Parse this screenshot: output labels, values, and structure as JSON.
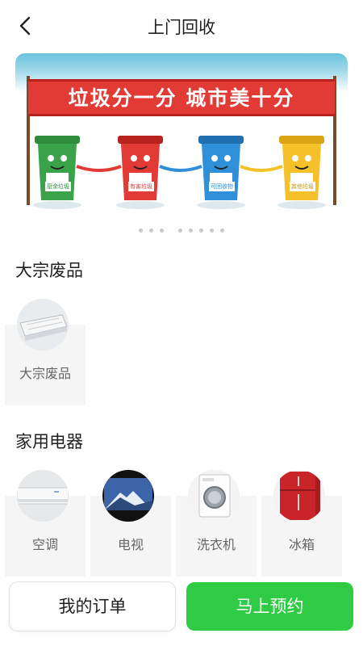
{
  "header": {
    "title": "上门回收",
    "back_icon": "chevron-left-icon"
  },
  "banner": {
    "slogan": "垃圾分一分  城市美十分",
    "bins": [
      {
        "label": "厨余垃圾",
        "color": "#3aa34a"
      },
      {
        "label": "有害垃圾",
        "color": "#e23a35"
      },
      {
        "label": "可回收物",
        "color": "#2f8fd8"
      },
      {
        "label": "其他垃圾",
        "color": "#f5c12b"
      }
    ],
    "slide_count": 8,
    "active_slide": 0
  },
  "sections": [
    {
      "title": "大宗废品",
      "items": [
        {
          "label": "大宗废品",
          "icon": "mattress-icon"
        }
      ]
    },
    {
      "title": "家用电器",
      "items": [
        {
          "label": "空调",
          "icon": "air-conditioner-icon"
        },
        {
          "label": "电视",
          "icon": "tv-icon"
        },
        {
          "label": "洗衣机",
          "icon": "washing-machine-icon"
        },
        {
          "label": "冰箱",
          "icon": "fridge-icon"
        }
      ]
    }
  ],
  "actions": {
    "orders_label": "我的订单",
    "book_label": "马上预约"
  },
  "colors": {
    "primary_green": "#2fcb45",
    "banner_sky": "#69c2df",
    "banner_red": "#e23a35"
  }
}
